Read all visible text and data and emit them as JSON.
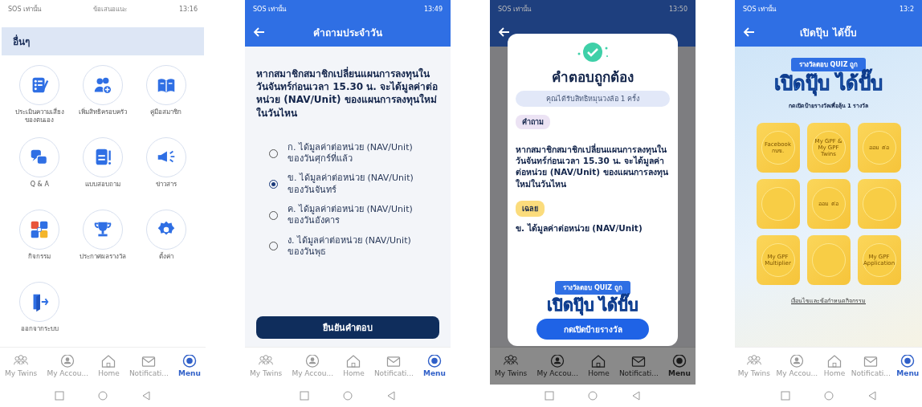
{
  "phones": [
    {
      "kind": "menu",
      "status": {
        "carrier": "SOS เท่านั้น",
        "time": "13:16"
      },
      "top_link": "ข้อเสนอแนะ",
      "section": "อื่นๆ",
      "items": [
        {
          "label": "ประเมินความเสี่ยงของตนเอง"
        },
        {
          "label": "เพิ่มสิทธิครอบครัว"
        },
        {
          "label": "คู่มือสมาชิก"
        },
        {
          "label": "Q & A"
        },
        {
          "label": "แบบสอบถาม"
        },
        {
          "label": "ข่าวสาร"
        },
        {
          "label": "กิจกรรม"
        },
        {
          "label": "ประกาศผลรางวัล"
        },
        {
          "label": "ตั้งค่า"
        },
        {
          "label": "ออกจากระบบ"
        }
      ],
      "tabs": [
        {
          "label": "My Twins",
          "selected": false
        },
        {
          "label": "My Accou...",
          "selected": false
        },
        {
          "label": "Home",
          "selected": false
        },
        {
          "label": "Notificati...",
          "selected": false
        },
        {
          "label": "Menu",
          "selected": true
        }
      ]
    },
    {
      "kind": "quiz",
      "status": {
        "carrier": "SOS เท่านั้น",
        "time": "13:49"
      },
      "title": "คำถามประจำวัน",
      "question": "หากสมาชิกสมาชิกเปลี่ยนแผนการลงทุนในวันจันทร์ก่อนเวลา 15.30 น. จะได้มูลค่าต่อหน่วย (NAV/Unit) ของแผนการลงทุนใหม่ในวันไหน",
      "options": [
        {
          "label": "ก. ได้มูลค่าต่อหน่วย (NAV/Unit) ของวันศุกร์ที่แล้ว",
          "selected": false
        },
        {
          "label": "ข. ได้มูลค่าต่อหน่วย (NAV/Unit) ของวันจันทร์",
          "selected": true
        },
        {
          "label": "ค. ได้มูลค่าต่อหน่วย (NAV/Unit) ของวันอังคาร",
          "selected": false
        },
        {
          "label": "ง. ได้มูลค่าต่อหน่วย (NAV/Unit) ของวันพุธ",
          "selected": false
        }
      ],
      "button": "ยืนยันคำตอบ",
      "tabs": [
        {
          "label": "My Twins",
          "selected": false
        },
        {
          "label": "My Accou...",
          "selected": false
        },
        {
          "label": "Home",
          "selected": false
        },
        {
          "label": "Notificati...",
          "selected": false
        },
        {
          "label": "Menu",
          "selected": true
        }
      ]
    },
    {
      "kind": "result",
      "status": {
        "carrier": "SOS เท่านั้น",
        "time": "13:50"
      },
      "modal": {
        "title": "คำตอบถูกต้อง",
        "reward": "คุณได้รับสิทธิหมุนวงล้อ 1 ครั้ง",
        "question_tag": "คำถาม",
        "question": "หากสมาชิกสมาชิกเปลี่ยนแผนการลงทุนในวันจันทร์ก่อนเวลา 15.30 น. จะได้มูลค่าต่อหน่วย (NAV/Unit) ของแผนการลงทุนใหม่ในวันไหน",
        "answer_tag": "เฉลย",
        "answer": "ข. ได้มูลค่าต่อหน่วย (NAV/Unit)",
        "banner_ribbon": "รางวัลตอบ QUIZ ถูก",
        "banner_title": "เปิดปุ๊บ ได้ปั๊บ",
        "button": "กดเปิดป้ายรางวัล"
      },
      "tabs": [
        {
          "label": "My Twins",
          "selected": false
        },
        {
          "label": "My Accou...",
          "selected": false
        },
        {
          "label": "Home",
          "selected": false
        },
        {
          "label": "Notificati...",
          "selected": false
        },
        {
          "label": "Menu",
          "selected": true
        }
      ]
    },
    {
      "kind": "prize",
      "status": {
        "carrier": "SOS เท่านั้น",
        "time": "13:2"
      },
      "title": "เปิดปุ๊บ ได้ปั๊บ",
      "banner_ribbon": "รางวัลตอบ QUIZ ถูก",
      "banner_title": "เปิดปุ๊บ ได้ปั๊บ",
      "subtitle": "กดเปิดป้ายรางวัลเพื่อลุ้น 1 รางวัล",
      "cards": [
        {
          "kind": "coin",
          "label": "Facebook กบข."
        },
        {
          "kind": "coin",
          "label": "My GPF & My GPF Twins"
        },
        {
          "kind": "coin",
          "label": "ออม ต่อ"
        },
        {
          "kind": "blank"
        },
        {
          "kind": "coin",
          "label": "ออม ต่อ"
        },
        {
          "kind": "blank"
        },
        {
          "kind": "coin",
          "label": "My GPF Multiplier"
        },
        {
          "kind": "blank"
        },
        {
          "kind": "coin",
          "label": "My GPF Application"
        }
      ],
      "link": "เงื่อนไขและข้อกำหนดกิจกรรม",
      "tabs": [
        {
          "label": "My Twins",
          "selected": false
        },
        {
          "label": "My Accou...",
          "selected": false
        },
        {
          "label": "Home",
          "selected": false
        },
        {
          "label": "Notificati...",
          "selected": false
        },
        {
          "label": "Menu",
          "selected": true
        }
      ]
    }
  ]
}
